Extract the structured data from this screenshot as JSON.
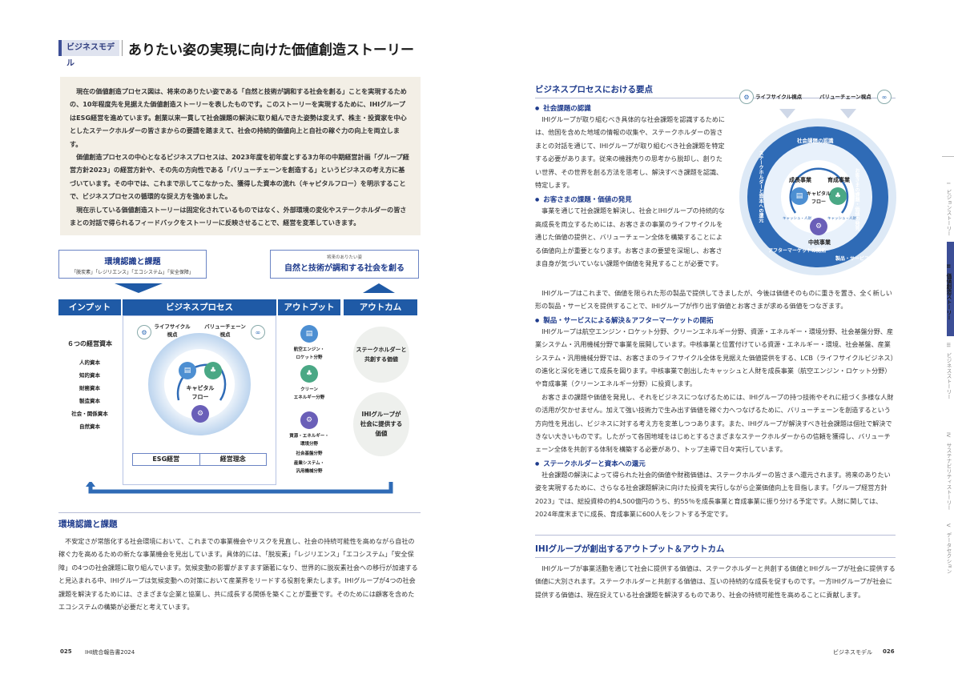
{
  "header": {
    "tag": "ビジネスモデル",
    "title": "ありたい姿の実現に向けた価値創造ストーリー"
  },
  "intro": {
    "p1": "現在の価値創造プロセス図は、将来のありたい姿である「自然と技術が調和する社会を創る」ことを実現するための、10年程度先を見据えた価値創造ストーリーを表したものです。このストーリーを実現するために、IHIグループはESG経営を進めています。創業以来一貫して社会課題の解決に取り組んできた姿勢は変えず、株主・投資家を中心としたステークホルダーの皆さまからの要請を踏まえて、社会の持続的価値向上と自社の稼ぐ力の向上を両立します。",
    "p2": "価値創造プロセスの中心となるビジネスプロセスは、2023年度を初年度とする3カ年の中期経営計画「グループ経営方針2023」の経営方針や、その先の方向性である「バリューチェーンを創造する」というビジネスの考え方に基づいています。その中では、これまで示してこなかった、獲得した資本の流れ（キャピタルフロー）を明示することで、ビジネスプロセスの循環的な捉え方を強めました。",
    "p3": "現在示している価値創造ストーリーは固定化されているものではなく、外部環境の変化やステークホルダーの皆さまとの対話で得られるフィードバックをストーリーに反映させることで、経営を変革していきます。"
  },
  "diagram": {
    "env_title": "環境認識と課題",
    "env_sub": "「脱炭素」「レジリエンス」「エコシステム」「安全保障」",
    "goal_small": "将来のありたい姿",
    "goal_title": "自然と技術が調和する社会を創る",
    "input_head": "インプット",
    "process_head": "ビジネスプロセス",
    "output_head": "アウトプット",
    "outcome_head": "アウトカム",
    "capital_title": "６つの経営資本",
    "capitals": [
      "人的資本",
      "知的資本",
      "財務資本",
      "製造資本",
      "社会・関係資本",
      "自然資本"
    ],
    "lifecycle": "ライフサイクル\n視点",
    "valuechain": "バリューチェーン\n視点",
    "capital_flow": "キャピタル\nフロー",
    "esg": "ESG経営",
    "philosophy": "経営理念",
    "outputs": [
      "航空エンジン・\nロケット分野",
      "クリーン\nエネルギー分野",
      "資源・エネルギー・\n環境分野",
      "社会基盤分野",
      "産業システム・\n汎用機械分野"
    ],
    "outcome1": "ステークホルダーと\n共創する価値",
    "outcome2": "IHIグループが\n社会に提供する\n価値"
  },
  "env_section": {
    "title": "環境認識と課題",
    "p1": "不安定さが常態化する社会環境において、これまでの事業機会やリスクを見直し、社会の持続可能性を高めながら自社の稼ぐ力を高めるための新たな事業機会を見出しています。具体的には、「脱炭素」「レジリエンス」「エコシステム」「安全保障」の4つの社会課題に取り組んでいます。気候変動の影響がますます顕著になり、世界的に脱炭素社会への移行が加速すると見込まれる中、IHIグループは気候変動への対策において産業界をリードする役割を果たします。IHIグループが4つの社会課題を解決するためには、さまざまな企業と協業し、共に成長する関係を築くことが重要です。そのためには顧客を含めたエコシステムの構築が必要だと考えています。"
  },
  "process_section": {
    "title": "ビジネスプロセスにおける要点",
    "b1_title": "社会課題の認識",
    "b1": "IHIグループが取り組むべき具体的な社会課題を認識するためには、他国を含めた地域の情報の収集や、ステークホルダーの皆さまとの対話を通じて、IHIグループが取り組むべき社会課題を特定する必要があります。従来の機器売りの思考から脱却し、創りたい世界、その世界を創る方法を思考し、解決すべき課題を認識、特定します。",
    "b2_title": "お客さまの課題・価値の発見",
    "b2": "事業を通じて社会課題を解決し、社会とIHIグループの持続的な高成長を両立するためには、お客さまの事業のライフサイクルを通じた価値の提供と、バリューチェーン全体を構築することによる価値向上が重要となります。お客さまの要望を深堀し、お客さま自身が気づいていない課題や価値を発見することが必要です。",
    "b2b": "IHIグループはこれまで、価値を限られた形の製品で提供してきましたが、今後は価値そのものに重きを置き、全く新しい形の製品・サービスを提供することで、IHIグループが作り出す価値とお客さまが求める価値をつなぎます。",
    "b3_title": "製品・サービスによる解決＆アフターマーケットの開拓",
    "b3": "IHIグループは航空エンジン・ロケット分野、クリーンエネルギー分野、資源・エネルギー・環境分野、社会基盤分野、産業システム・汎用機械分野で事業を展開しています。中核事業と位置付けている資源・エネルギー・環境、社会基盤、産業システム・汎用機械分野では、お客さまのライフサイクル全体を見据えた価値提供をする、LCB（ライフサイクルビジネス）の進化と深化を通じて成長を図ります。中核事業で創出したキャッシュと人財を成長事業（航空エンジン・ロケット分野）や育成事業（クリーンエネルギー分野）に投資します。",
    "b3b": "お客さまの課題や価値を発見し、それをビジネスにつなげるためには、IHIグループの持つ技術やそれに紐づく多様な人財の活用が欠かせません。加えて強い技術力で生み出す価値を稼ぐ力へつなげるために、バリューチェーンを創造するという方向性を見出し、ビジネスに対する考え方を変革しつつあります。また、IHIグループが解決すべき社会課題は個社で解決できない大きいものです。したがって各国地域をはじめとするさまざまなステークホルダーからの信頼を獲得し、バリューチェーン全体を共創する体制を構築する必要があり、トップ主導で日々実行しています。",
    "b4_title": "ステークホルダーと資本への還元",
    "b4": "社会課題の解決によって得られた社会的価値や財務価値は、ステークホルダーの皆さまへ還元されます。将来のありたい姿を実現するために、さらなる社会課題解決に向けた投資を実行しながら企業価値向上を目指します。「グループ経営方針2023」では、総投資枠の約4,500億円のうち、約55％を成長事業と育成事業に振り分ける予定です。人財に関しては、2024年度末までに成長、育成事業に600人をシフトする予定です。"
  },
  "ring": {
    "lifecycle": "ライフサイクル視点",
    "valuechain": "バリューチェーン視点",
    "r1": "社会課題の認識",
    "r2": "お客さまの課題・価値の発見",
    "r3": "製品・サービスによる解決",
    "r4": "アフターマーケットの開拓",
    "r5": "ステークホルダーと資本への還元",
    "growth": "成長事業",
    "nurture": "育成事業",
    "core": "中核事業",
    "flow": "キャピタル\nフロー",
    "cash": "キャッシュ・人財"
  },
  "output_section": {
    "title": "IHIグループが創出するアウトプット＆アウトカム",
    "p1": "IHIグループが事業活動を通じて社会に提供する価値は、ステークホルダーと共創する価値とIHIグループが社会に提供する価値に大別されます。ステークホルダーと共創する価値は、互いの持続的な成長を促すものです。一方IHIグループが社会に提供する価値は、現在捉えている社会課題を解決するものであり、社会の持続可能性を高めることに貢献します。"
  },
  "sidebar": [
    {
      "num": "I",
      "label": "ビジョンストーリー"
    },
    {
      "num": "II",
      "label": "価値創造ストーリー"
    },
    {
      "num": "III",
      "label": "ビジネスストーリー"
    },
    {
      "num": "IV",
      "label": "サステナビリティストーリー"
    },
    {
      "num": "V",
      "label": "データセクション"
    }
  ],
  "footer": {
    "left_page": "025",
    "left_title": "IHI統合報告書2024",
    "right_label": "ビジネスモデル",
    "right_page": "026"
  },
  "colors": {
    "brand": "#1f5aa6",
    "accent": "#3c4e96",
    "beige": "#f3efe6"
  }
}
